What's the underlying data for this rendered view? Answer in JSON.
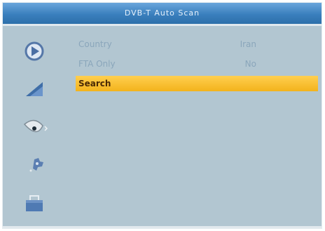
{
  "window": {
    "title": "DVB-T Auto Scan"
  },
  "sidebar": {
    "items": [
      {
        "icon": "play-icon"
      },
      {
        "icon": "signal-icon"
      },
      {
        "icon": "satellite-dish-icon"
      },
      {
        "icon": "settings-puzzle-icon"
      },
      {
        "icon": "folder-icon"
      }
    ]
  },
  "menu": {
    "country": {
      "label": "Country",
      "value": "Iran"
    },
    "fta_only": {
      "label": "FTA Only",
      "value": "No"
    },
    "search": {
      "label": "Search"
    }
  },
  "colors": {
    "background": "#b2c6d1",
    "title_bar": "#3a7fbd",
    "highlight": "#f3b31c"
  }
}
